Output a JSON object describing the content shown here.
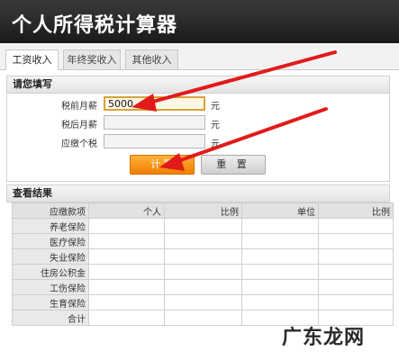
{
  "app": {
    "title": "个人所得税计算器"
  },
  "tabs": [
    {
      "label": "工资收入",
      "active": true
    },
    {
      "label": "年终奖收入",
      "active": false
    },
    {
      "label": "其他收入",
      "active": false
    }
  ],
  "form": {
    "heading": "请您填写",
    "fields": [
      {
        "label": "税前月薪",
        "value": "5000",
        "unit": "元"
      },
      {
        "label": "税后月薪",
        "value": "",
        "unit": "元"
      },
      {
        "label": "应缴个税",
        "value": "",
        "unit": "元"
      }
    ],
    "calc_button": "计 算",
    "reset_button": "重 置"
  },
  "results": {
    "heading": "查看结果",
    "columns": [
      "应缴款项",
      "个人",
      "比例",
      "单位",
      "比例"
    ],
    "rows": [
      "养老保险",
      "医疗保险",
      "失业保险",
      "住房公积金",
      "工伤保险",
      "生育保险",
      "合计"
    ]
  },
  "watermark": "广东龙网",
  "colors": {
    "arrow": "#e21a1a",
    "calc_button": "#f5900f",
    "header": "#222222"
  }
}
